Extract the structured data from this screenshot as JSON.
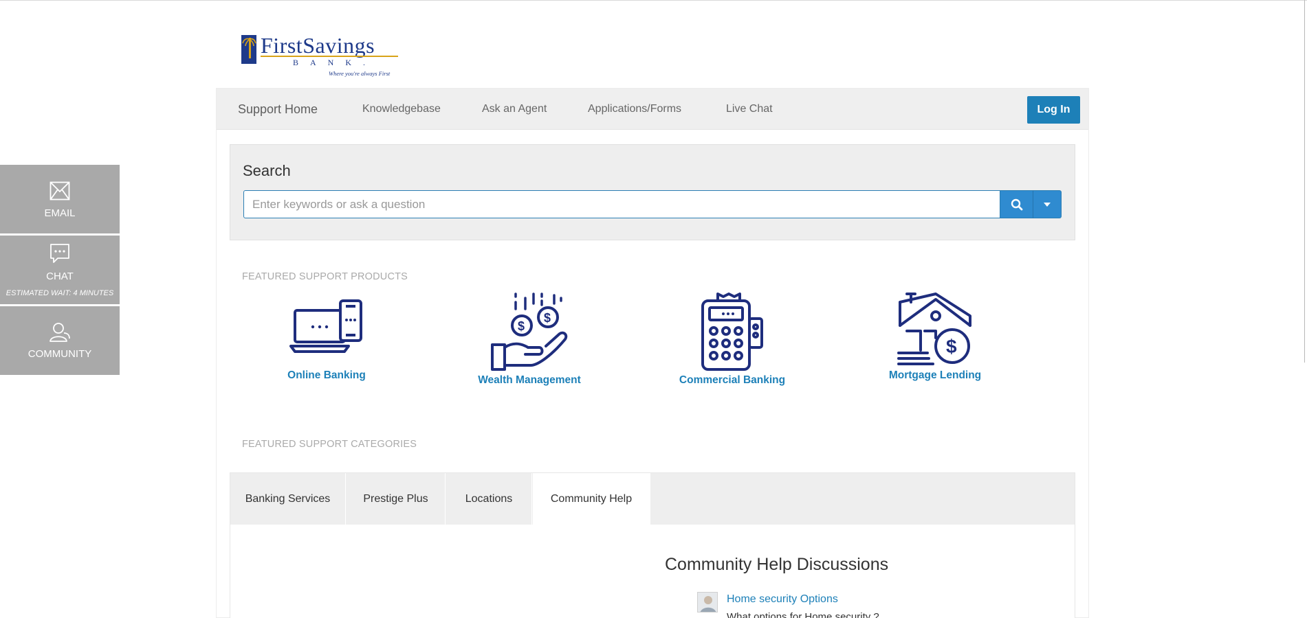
{
  "brand": {
    "name_first": "First",
    "name_second": "Savings",
    "bank": "BANK.",
    "tagline": "Where you're always First"
  },
  "nav": {
    "items": [
      {
        "label": "Support Home"
      },
      {
        "label": "Knowledgebase"
      },
      {
        "label": "Ask an Agent"
      },
      {
        "label": "Applications/Forms"
      },
      {
        "label": "Live Chat"
      }
    ],
    "login_label": "Log In"
  },
  "search": {
    "title": "Search",
    "placeholder": "Enter keywords or ask a question",
    "value": ""
  },
  "featured_products": {
    "heading": "FEATURED SUPPORT PRODUCTS",
    "items": [
      {
        "label": "Online Banking",
        "icon": "laptop-phone-icon"
      },
      {
        "label": "Wealth Management",
        "icon": "hand-coins-icon"
      },
      {
        "label": "Commercial Banking",
        "icon": "calculator-icon"
      },
      {
        "label": "Mortgage Lending",
        "icon": "house-dollar-icon"
      }
    ]
  },
  "featured_categories": {
    "heading": "FEATURED SUPPORT CATEGORIES",
    "tabs": [
      {
        "label": "Banking Services",
        "active": false
      },
      {
        "label": "Prestige Plus",
        "active": false
      },
      {
        "label": "Locations",
        "active": false
      },
      {
        "label": "Community Help",
        "active": true
      }
    ]
  },
  "community": {
    "title": "Community Help Discussions",
    "discussions": [
      {
        "title": "Home security Options",
        "snippet": "What options for Home security ?"
      }
    ]
  },
  "side_widget": {
    "email": {
      "label": "EMAIL"
    },
    "chat": {
      "label": "CHAT",
      "sub": "ESTIMATED WAIT: 4 MINUTES"
    },
    "community": {
      "label": "COMMUNITY"
    }
  },
  "colors": {
    "accent": "#1d80b8",
    "icon_navy": "#1e2d7d",
    "nav_bg": "#efefef",
    "widget_bg": "#a9a9a9"
  }
}
